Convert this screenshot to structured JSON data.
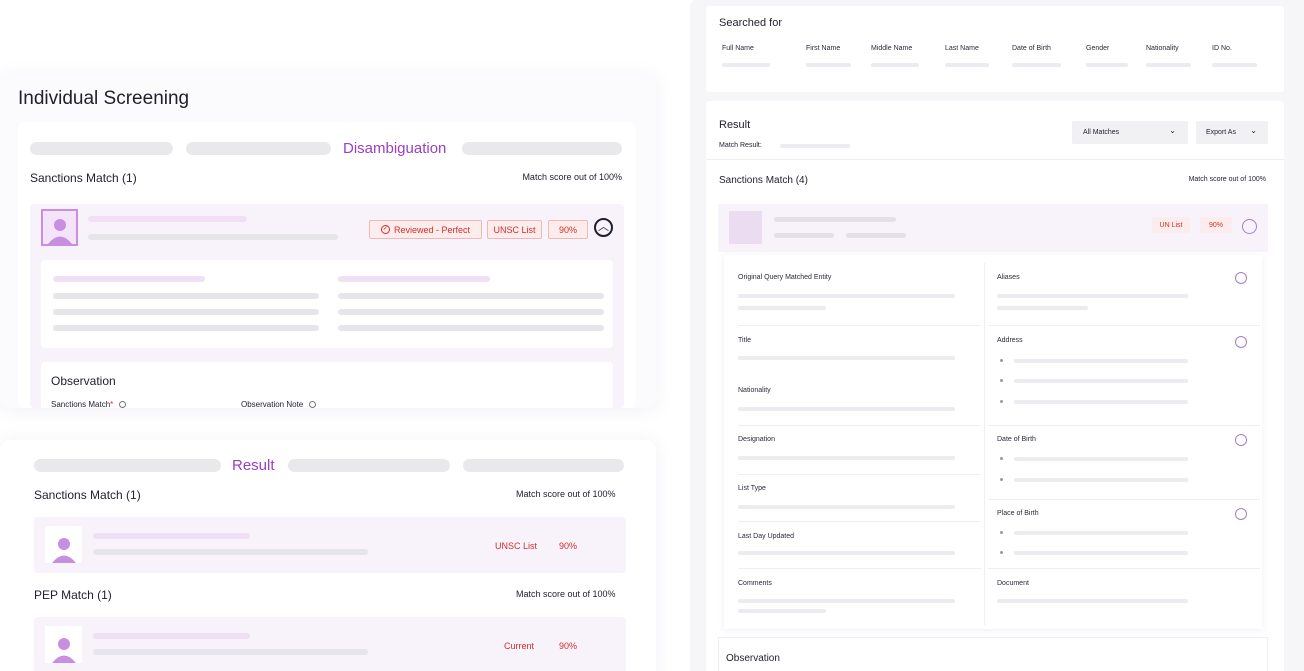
{
  "left": {
    "title": "Individual Screening",
    "disambiguation": {
      "active_step": "Disambiguation",
      "section_title": "Sanctions Match (1)",
      "score_note": "Match score out of 100%",
      "reviewed_badge": "Reviewed - Perfect",
      "list_badge": "UNSC List",
      "score_badge": "90%",
      "observation_title": "Observation",
      "sanctions_match_label": "Sanctions Match",
      "required_mark": "*",
      "observation_note_label": "Observation Note"
    },
    "result": {
      "active_step": "Result",
      "sanctions_title": "Sanctions Match (1)",
      "sanctions_score_note": "Match score out of 100%",
      "sanctions_list": "UNSC List",
      "sanctions_score": "90%",
      "pep_title": "PEP Match (1)",
      "pep_score_note": "Match score out of 100%",
      "pep_status": "Current",
      "pep_score": "90%"
    }
  },
  "right": {
    "searched_for": {
      "title": "Searched for",
      "columns": [
        "Full Name",
        "First Name",
        "Middle Name",
        "Last Name",
        "Date of Birth",
        "Gender",
        "Nationality",
        "ID No."
      ]
    },
    "result": {
      "title": "Result",
      "match_result_label": "Match Result:",
      "filter_select": "All Matches",
      "export_button": "Export As",
      "section_title": "Sanctions Match (4)",
      "score_note": "Match score out of 100%",
      "list_badge": "UN List",
      "score_badge": "90%",
      "fields": {
        "original_query": "Original Query Matched Entity",
        "aliases": "Aliases",
        "title": "Title",
        "address": "Address",
        "nationality": "Nationality",
        "designation": "Designation",
        "date_of_birth": "Date of Birth",
        "list_type": "List Type",
        "place_of_birth": "Place of Birth",
        "last_day_updated": "Last Day Updated",
        "comments": "Comments",
        "document": "Document"
      },
      "observation_title": "Observation"
    }
  }
}
